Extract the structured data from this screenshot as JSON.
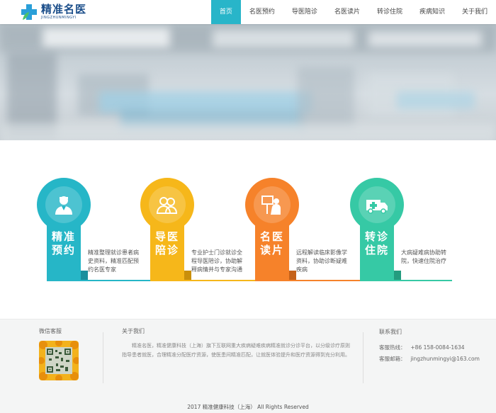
{
  "logo": {
    "title": "精准名医",
    "subtitle": "JINGZHUNMINGYI"
  },
  "nav": [
    "首页",
    "名医预约",
    "导医陪诊",
    "名医读片",
    "转诊住院",
    "疾病知识",
    "关于我们"
  ],
  "nav_active_index": 0,
  "services": [
    {
      "title_line1": "精准",
      "title_line2": "预约",
      "desc": "精准整理就诊患者病史资料，精准匹配预约名医专家",
      "icon": "doctor-icon",
      "color": "#26b6c7"
    },
    {
      "title_line1": "导医",
      "title_line2": "陪诊",
      "desc": "专业护士门诊就诊全程导医陪诊，协助解释病情并与专家沟通",
      "icon": "people-icon",
      "color": "#f6b71a"
    },
    {
      "title_line1": "名医",
      "title_line2": "读片",
      "desc": "远程解读临床影像学资料，协助诊断疑难疾病",
      "icon": "presentation-icon",
      "color": "#f6822a"
    },
    {
      "title_line1": "转诊",
      "title_line2": "住院",
      "desc": "大病疑难病协助转院，快速住院治疗",
      "icon": "ambulance-icon",
      "color": "#36c9a5"
    }
  ],
  "footer": {
    "wechat_title": "微信客服",
    "about_title": "关于我们",
    "about_text": "精准名医，精准健康科技（上海）旗下互联网重大疾病疑难疾病精准就诊分诊平台，以分级诊疗原则指导患者就医，合理精准分配医疗资源，使医患间精准匹配，让就医体验提升和医疗资源得到充分利用。",
    "contact_title": "联系我们",
    "hotline_label": "客服热线：",
    "hotline": "+86 158-0084-1634",
    "email_label": "客服邮箱：",
    "email": "jingzhunmingyi@163.com",
    "copyright": "2017 精准健康科技（上海） All Rights Reserved"
  }
}
